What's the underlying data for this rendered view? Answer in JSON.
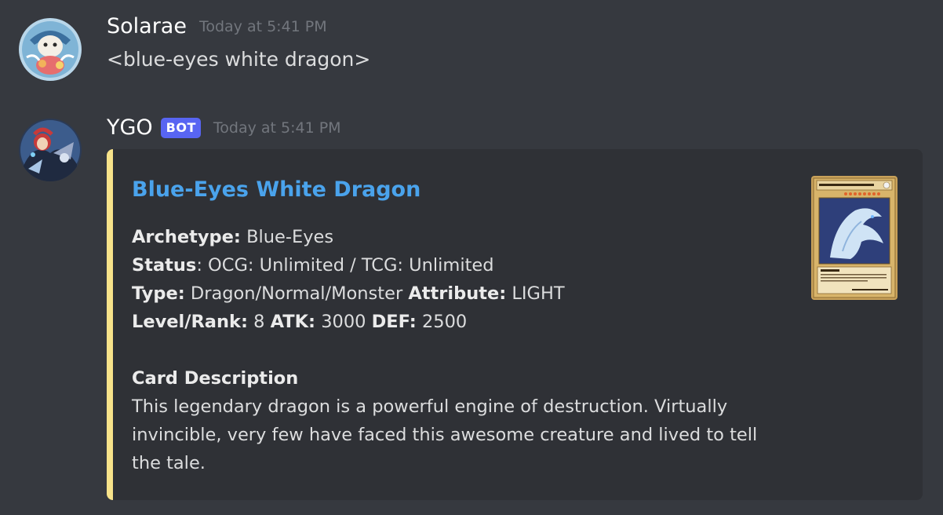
{
  "messages": [
    {
      "username": "Solarae",
      "timestamp": "Today at 5:41 PM",
      "content": "<blue-eyes white dragon>",
      "avatar_icon": "avatar-solarae-icon"
    },
    {
      "username": "YGO",
      "bot_tag": "BOT",
      "timestamp": "Today at 5:41 PM",
      "avatar_icon": "avatar-ygo-icon"
    }
  ],
  "embed": {
    "accent_color": "#f8e38a",
    "title": "Blue-Eyes White Dragon",
    "fields": {
      "archetype_label": "Archetype:",
      "archetype_value": "Blue-Eyes",
      "status_label": "Status",
      "status_value": ": OCG: Unlimited / TCG: Unlimited",
      "type_label": "Type:",
      "type_value": "Dragon/Normal/Monster",
      "attribute_label": "Attribute:",
      "attribute_value": "LIGHT",
      "level_label": "Level/Rank:",
      "level_value": "8",
      "atk_label": "ATK:",
      "atk_value": "3000",
      "def_label": "DEF:",
      "def_value": "2500"
    },
    "description_heading": "Card Description",
    "description": "This legendary dragon is a powerful engine of destruction. Virtually invincible, very few have faced this awesome creature and lived to tell the tale.",
    "thumbnail": {
      "card_name": "Blue-Eyes White Dragon",
      "icon": "card-image-icon"
    }
  },
  "colors": {
    "background": "#36393f",
    "embed_background": "#2f3136",
    "link": "#4aa3ec",
    "bot_tag": "#5865f2"
  }
}
